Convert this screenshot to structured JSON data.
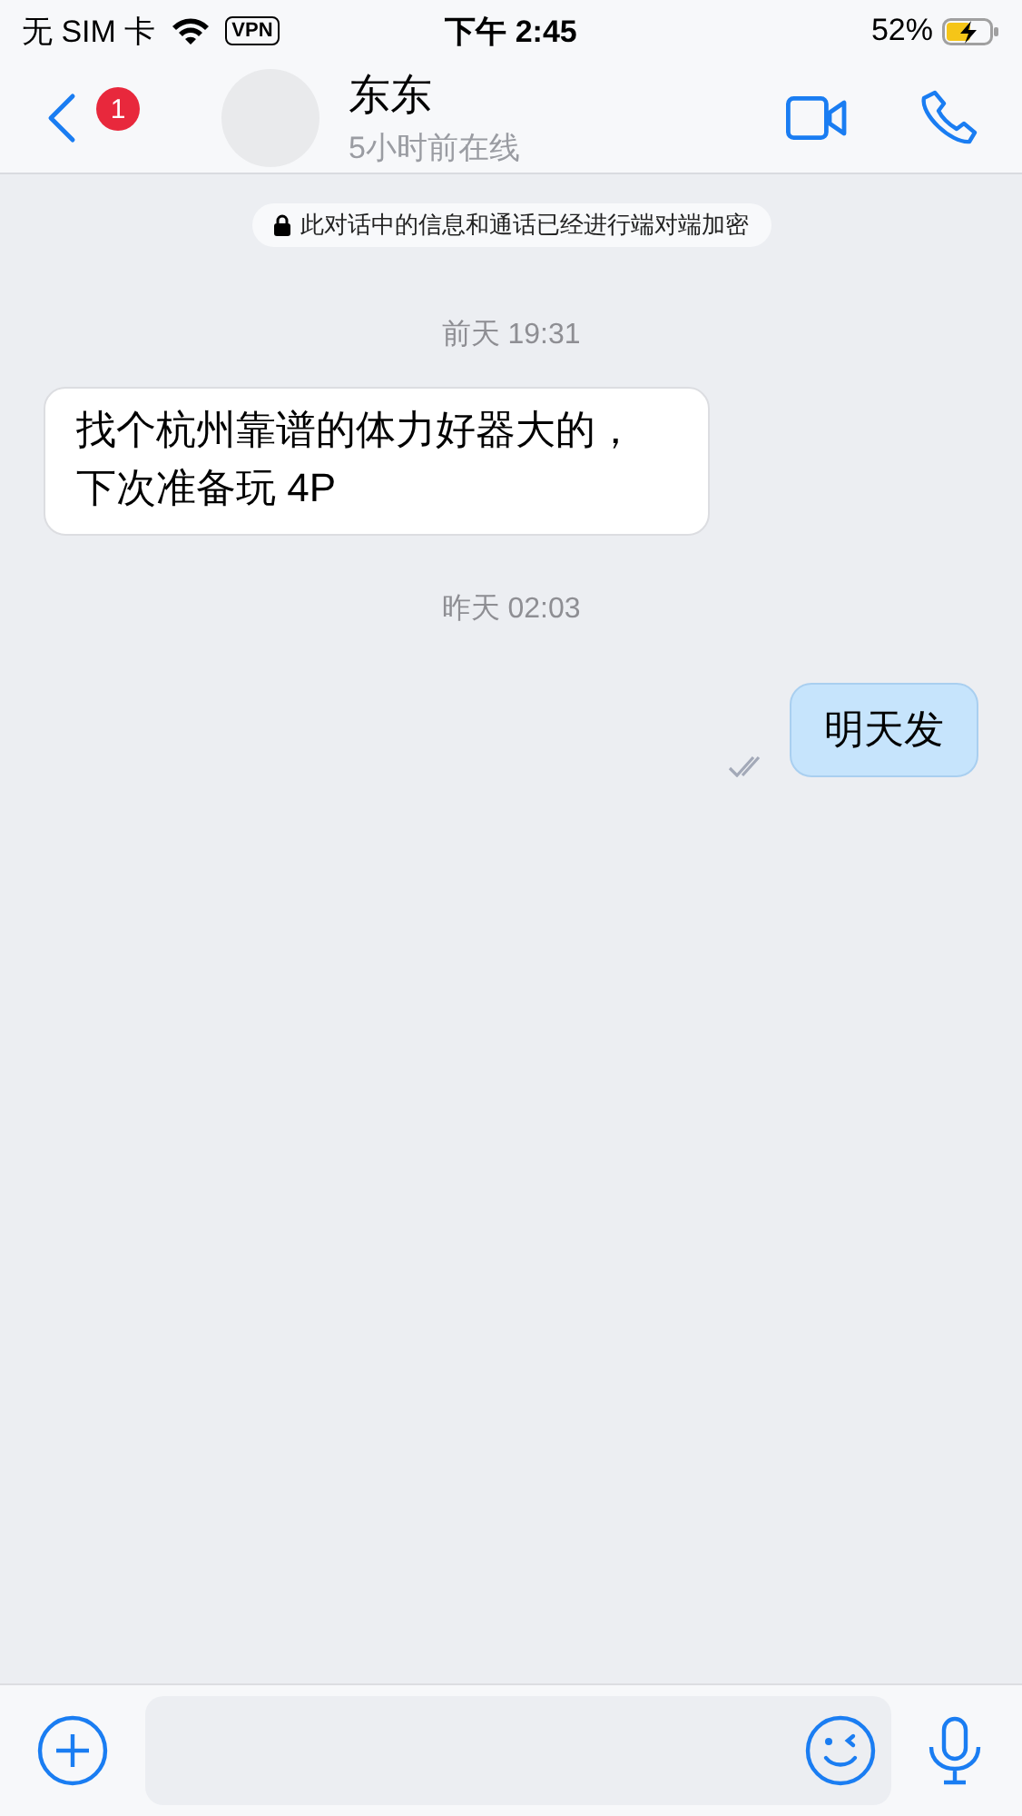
{
  "status_bar": {
    "carrier": "无 SIM 卡",
    "vpn": "VPN",
    "time": "下午 2:45",
    "battery": "52%"
  },
  "header": {
    "unread_badge": "1",
    "name": "东东",
    "last_seen": "5小时前在线"
  },
  "messages": [
    {
      "kind": "notice",
      "text": "此对话中的信息和通话已经进行端对端加密"
    },
    {
      "kind": "date",
      "text": "前天 19:31"
    },
    {
      "kind": "incoming",
      "lines": [
        "找个杭州靠谱的体力好器大的，",
        "下次准备玩 4P"
      ]
    },
    {
      "kind": "date",
      "text": "昨天 02:03"
    },
    {
      "kind": "outgoing",
      "lines": [
        "明天发"
      ]
    }
  ]
}
